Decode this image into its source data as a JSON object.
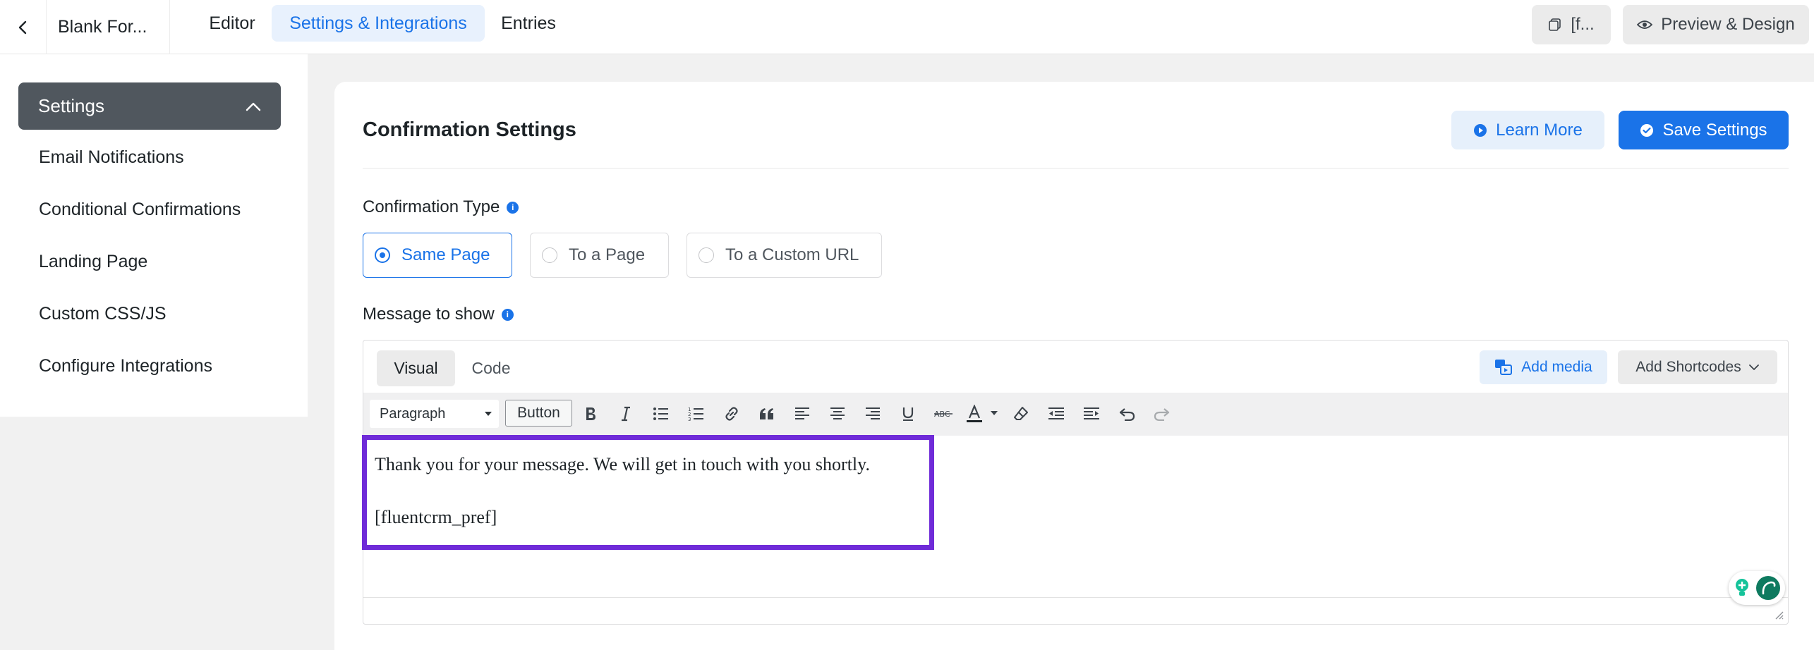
{
  "header": {
    "form_title": "Blank For...",
    "tabs": [
      {
        "label": "Editor",
        "active": false
      },
      {
        "label": "Settings & Integrations",
        "active": true
      },
      {
        "label": "Entries",
        "active": false
      }
    ],
    "shortcode_button": "[f...",
    "preview_button": "Preview & Design"
  },
  "sidebar": {
    "active_section": "Settings",
    "items": [
      {
        "label": "Email Notifications"
      },
      {
        "label": "Conditional Confirmations"
      },
      {
        "label": "Landing Page"
      },
      {
        "label": "Custom CSS/JS"
      },
      {
        "label": "Configure Integrations"
      }
    ]
  },
  "main": {
    "title": "Confirmation Settings",
    "learn_more": "Learn More",
    "save_settings": "Save Settings",
    "confirmation_type": {
      "label": "Confirmation Type",
      "options": [
        {
          "label": "Same Page",
          "selected": true
        },
        {
          "label": "To a Page",
          "selected": false
        },
        {
          "label": "To a Custom URL",
          "selected": false
        }
      ]
    },
    "message": {
      "label": "Message to show",
      "editor_tabs": {
        "visual": "Visual",
        "code": "Code"
      },
      "add_media": "Add media",
      "add_shortcodes": "Add Shortcodes",
      "toolbar": {
        "format": "Paragraph",
        "button": "Button",
        "icons": [
          "bold-icon",
          "italic-icon",
          "bullet-list-icon",
          "numbered-list-icon",
          "link-icon",
          "blockquote-icon",
          "align-left-icon",
          "align-center-icon",
          "align-right-icon",
          "underline-icon",
          "strikethrough-icon",
          "text-color-icon",
          "clear-format-icon",
          "outdent-icon",
          "indent-icon",
          "undo-icon",
          "redo-icon"
        ]
      },
      "content_line1": "Thank you for your message. We will get in touch with you shortly.",
      "content_line2": "[fluentcrm_pref]"
    }
  },
  "colors": {
    "accent": "#1a73e8",
    "sidebar_active": "#50575e",
    "highlight": "#6f2bd8",
    "grammarly": "#15c39a"
  }
}
